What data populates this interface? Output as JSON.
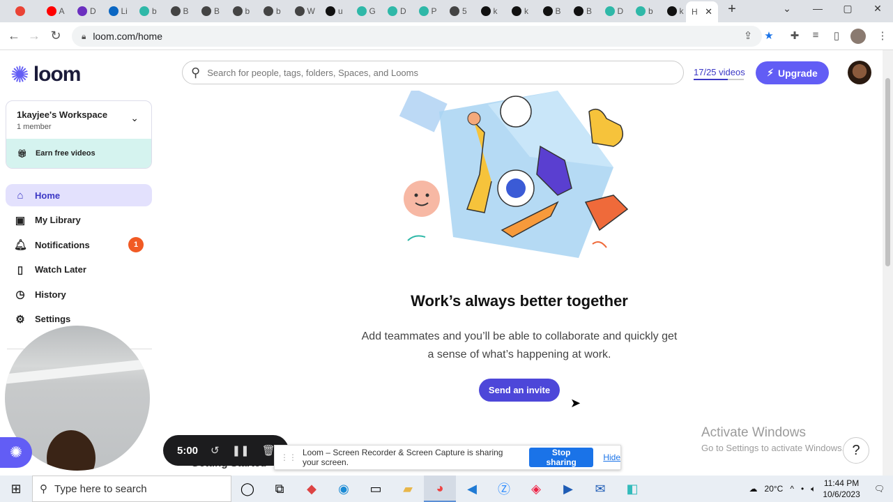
{
  "browser": {
    "tabs": [
      {
        "label": "",
        "color": "#ea4335"
      },
      {
        "label": "A",
        "color": "#ff0000"
      },
      {
        "label": "D",
        "color": "#6b2fbf"
      },
      {
        "label": "Li",
        "color": "#0a66c2"
      },
      {
        "label": "b",
        "color": "#2fb8a8"
      },
      {
        "label": "B",
        "color": "#444444"
      },
      {
        "label": "B",
        "color": "#444444"
      },
      {
        "label": "b",
        "color": "#444444"
      },
      {
        "label": "b",
        "color": "#444444"
      },
      {
        "label": "W",
        "color": "#444444"
      },
      {
        "label": "u",
        "color": "#111111"
      },
      {
        "label": "G",
        "color": "#2fb8a8"
      },
      {
        "label": "D",
        "color": "#2fb8a8"
      },
      {
        "label": "P",
        "color": "#2fb8a8"
      },
      {
        "label": "5",
        "color": "#444444"
      },
      {
        "label": "k",
        "color": "#111111"
      },
      {
        "label": "k",
        "color": "#111111"
      },
      {
        "label": "B",
        "color": "#111111"
      },
      {
        "label": "B",
        "color": "#111111"
      },
      {
        "label": "D",
        "color": "#2fb8a8"
      },
      {
        "label": "b",
        "color": "#2fb8a8"
      },
      {
        "label": "k",
        "color": "#111111"
      }
    ],
    "active_tab": {
      "label": "H",
      "close": "✕"
    },
    "new_tab": "+",
    "url": "loom.com/home",
    "window_controls": {
      "dropdown": "⌄",
      "minimize": "—",
      "maximize": "▢",
      "close": "✕"
    }
  },
  "app": {
    "logo_text": "loom",
    "brand_color": "#625df5",
    "workspace": {
      "name": "1kayjee's Workspace",
      "members": "1 member"
    },
    "earn_label": "Earn free videos",
    "nav": [
      {
        "label": "Home",
        "icon": "home-icon",
        "active": true
      },
      {
        "label": "My Library",
        "icon": "library-icon"
      },
      {
        "label": "Notifications",
        "icon": "bell-icon",
        "badge": "1"
      },
      {
        "label": "Watch Later",
        "icon": "bookmark-icon"
      },
      {
        "label": "History",
        "icon": "clock-icon"
      },
      {
        "label": "Settings",
        "icon": "gear-icon"
      }
    ],
    "search_placeholder": "Search for people, tags, folders, Spaces, and Looms",
    "videos_count": "17/25 videos",
    "videos_fraction": 0.68,
    "upgrade_label": "Upgrade",
    "headline": "Work’s always better together",
    "subtext": "Add teammates and you’ll be able to collaborate and quickly get a sense of what’s happening at work.",
    "invite_label": "Send an invite",
    "getting_started": "Getting Started"
  },
  "recorder": {
    "timer": "5:00",
    "share_text": "Loom – Screen Recorder & Screen Capture is sharing your screen.",
    "stop_label": "Stop sharing",
    "hide_label": "Hide"
  },
  "watermark": {
    "title": "Activate Windows",
    "subtitle": "Go to Settings to activate Windows."
  },
  "help_label": "?",
  "taskbar": {
    "search_placeholder": "Type here to search",
    "temperature": "20°C",
    "time": "11:44 PM",
    "date": "10/6/2023"
  }
}
